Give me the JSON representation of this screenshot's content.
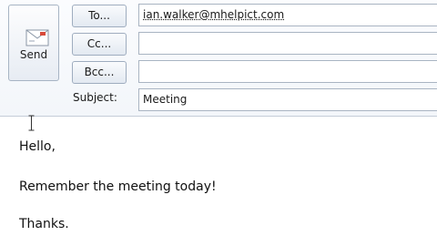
{
  "send_button": {
    "label": "Send",
    "icon": "envelope-send-icon"
  },
  "fields": {
    "to": {
      "button_label": "To...",
      "value": "ian.walker@mhelpict.com"
    },
    "cc": {
      "button_label": "Cc...",
      "value": ""
    },
    "bcc": {
      "button_label": "Bcc...",
      "value": ""
    },
    "subject": {
      "label": "Subject:",
      "value": "Meeting"
    }
  },
  "message_body": {
    "greeting": "Hello,",
    "line1": "Remember the meeting today!",
    "closing": "Thanks."
  },
  "colors": {
    "header_background": "#f3f6fa",
    "button_border": "#9fadbf",
    "field_border": "#a9b4c2"
  }
}
